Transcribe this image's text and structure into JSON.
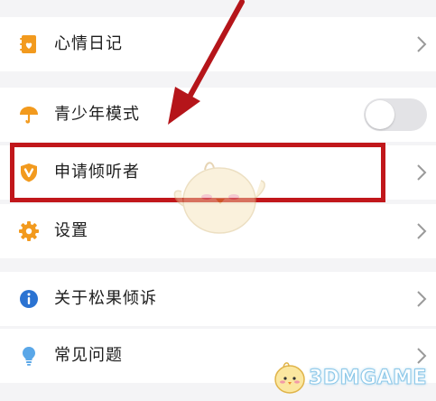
{
  "menu": {
    "items": [
      {
        "label": "心情日记",
        "icon": "diary-icon"
      },
      {
        "label": "青少年模式",
        "icon": "umbrella-icon",
        "toggle_on": false
      },
      {
        "label": "申请倾听者",
        "icon": "shield-v-icon"
      },
      {
        "label": "设置",
        "icon": "gear-icon"
      },
      {
        "label": "关于松果倾诉",
        "icon": "info-icon"
      },
      {
        "label": "常见问题",
        "icon": "lightbulb-icon"
      }
    ]
  },
  "colors": {
    "accent_orange": "#f29a1e",
    "info_blue": "#2b73d2",
    "highlight_red": "#c1171b"
  },
  "watermark": {
    "text": "3DMGAME"
  }
}
